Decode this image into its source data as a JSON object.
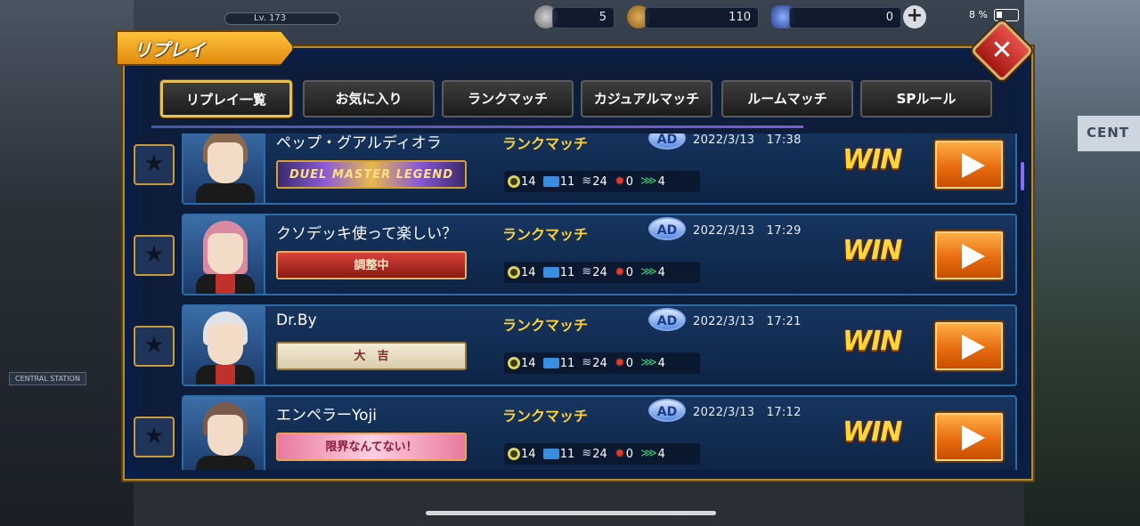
{
  "status_bar": {
    "level": "Lv. 173",
    "currency_1": "5",
    "currency_2": "110",
    "currency_3": "0",
    "battery": "8 %"
  },
  "header": {
    "title": "リプレイ",
    "close_label": "✕"
  },
  "tabs": [
    {
      "label": "リプレイ一覧",
      "active": true
    },
    {
      "label": "お気に入り",
      "active": false
    },
    {
      "label": "ランクマッチ",
      "active": false
    },
    {
      "label": "カジュアルマッチ",
      "active": false
    },
    {
      "label": "ルームマッチ",
      "active": false
    },
    {
      "label": "SPルール",
      "active": false
    }
  ],
  "background": {
    "right_sign": "CENT",
    "left_sign": "CENTRAL STATION"
  },
  "replays": [
    {
      "name": "ペップ・グアルディオラ",
      "mode": "ランクマッチ",
      "format_badge": "AD",
      "date": "2022/3/13",
      "time": "17:38",
      "emblem": "DUEL MASTER LEGEND",
      "stats": [
        "14",
        "11",
        "24",
        "0",
        "4"
      ],
      "result": "WIN",
      "hair_color": "#8a6a4e"
    },
    {
      "name": "クソデッキ使って楽しい？",
      "mode": "ランクマッチ",
      "format_badge": "AD",
      "date": "2022/3/13",
      "time": "17:29",
      "emblem": "調整中",
      "stats": [
        "14",
        "11",
        "24",
        "0",
        "4"
      ],
      "result": "WIN",
      "hair_color": "#d98aa0"
    },
    {
      "name": "Dr.By",
      "mode": "ランクマッチ",
      "format_badge": "AD",
      "date": "2022/3/13",
      "time": "17:21",
      "emblem": "大　吉",
      "stats": [
        "14",
        "11",
        "24",
        "0",
        "4"
      ],
      "result": "WIN",
      "hair_color": "#dfe3e6"
    },
    {
      "name": "エンペラーYoji",
      "mode": "ランクマッチ",
      "format_badge": "AD",
      "date": "2022/3/13",
      "time": "17:12",
      "emblem": "限界なんてない！",
      "stats": [
        "14",
        "11",
        "24",
        "0",
        "4"
      ],
      "result": "WIN",
      "hair_color": "#7a5a4a"
    }
  ],
  "colors": {
    "accent_gold": "#ffd23a",
    "panel_bg": "#0d1d3a",
    "play_orange": "#e86c10"
  },
  "icons": {
    "favorite": "star-icon",
    "play": "play-icon",
    "close": "close-icon",
    "add": "plus-icon"
  }
}
